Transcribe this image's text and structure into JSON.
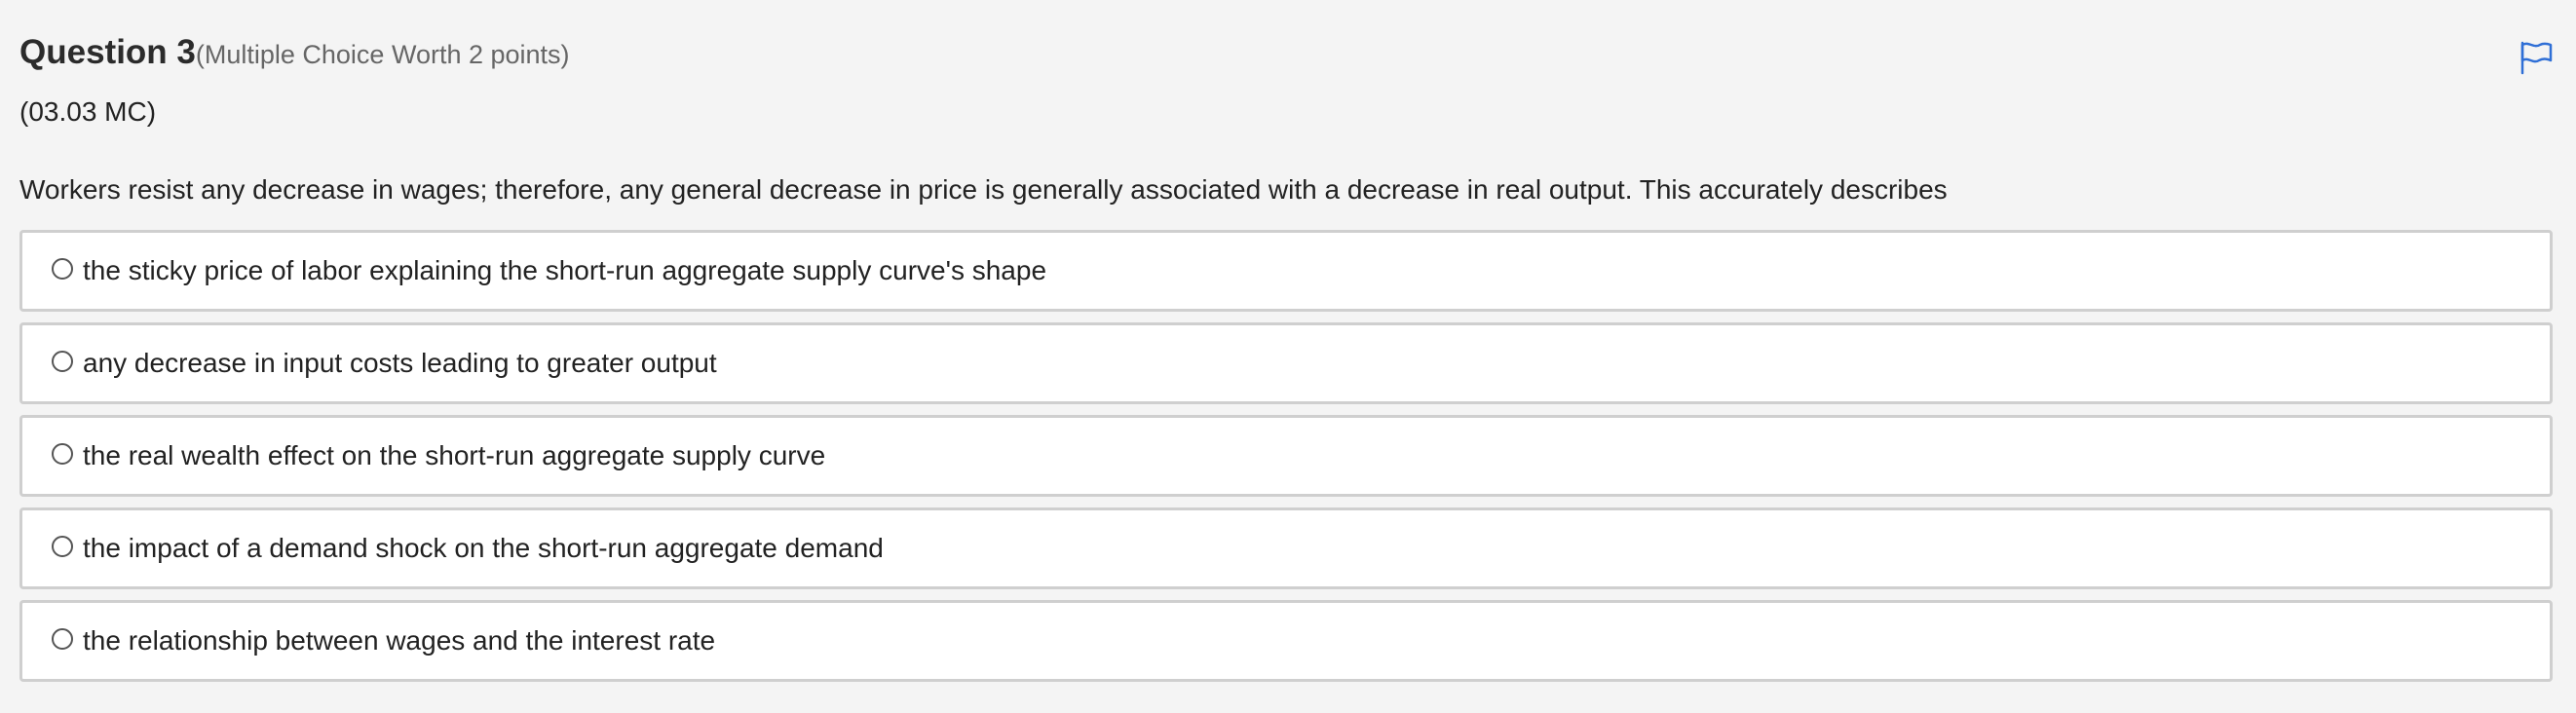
{
  "question": {
    "title": "Question 3",
    "worth": "(Multiple Choice Worth 2 points)",
    "code": "(03.03 MC)",
    "text": "Workers resist any decrease in wages; therefore, any general decrease in price is generally associated with a decrease in real output. This accurately describes",
    "flag_icon": "flag-icon",
    "flag_color": "#2f6fd6"
  },
  "choices": [
    {
      "label": "the sticky price of labor explaining the short-run aggregate supply curve's shape",
      "selected": false
    },
    {
      "label": "any decrease in input costs leading to greater output",
      "selected": false
    },
    {
      "label": "the real wealth effect on the short-run aggregate supply curve",
      "selected": false
    },
    {
      "label": "the impact of a demand shock on the short-run aggregate demand",
      "selected": false
    },
    {
      "label": "the relationship between wages and the interest rate",
      "selected": false
    }
  ]
}
